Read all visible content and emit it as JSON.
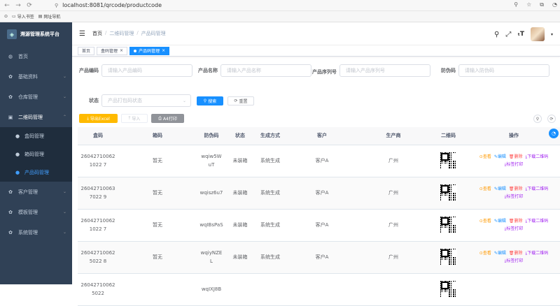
{
  "browser": {
    "url": "localhost:8081/qrcode/productcode",
    "bookmarks": [
      "导入书签",
      "网址导航"
    ]
  },
  "sidebar": {
    "title": "溯源管理系统平台",
    "items": [
      {
        "label": "首页",
        "icon": "dashboard-icon"
      },
      {
        "label": "基础资料",
        "icon": "settings-icon"
      },
      {
        "label": "仓库管理",
        "icon": "settings-icon"
      },
      {
        "label": "二维码管理",
        "icon": "qrcode-icon"
      },
      {
        "label": "盒码管理",
        "icon": "user-icon"
      },
      {
        "label": "箱码管理",
        "icon": "user-icon"
      },
      {
        "label": "产品码管理",
        "icon": "user-icon"
      },
      {
        "label": "客户管理",
        "icon": "settings-icon"
      },
      {
        "label": "模板管理",
        "icon": "settings-icon"
      },
      {
        "label": "系统管理",
        "icon": "settings-icon"
      }
    ]
  },
  "header": {
    "breadcrumb": [
      "首页",
      "二维码管理",
      "产品码管理"
    ]
  },
  "tags": [
    "首页",
    "盒码管理",
    "产品码管理"
  ],
  "filters": {
    "product_code": {
      "label": "产品编码",
      "placeholder": "请输入产品编码"
    },
    "product_name": {
      "label": "产品名称",
      "placeholder": "请输入产品名称"
    },
    "serial_no": {
      "label": "产品序列号",
      "placeholder": "请输入产品序列号"
    },
    "anti_fake": {
      "label": "防伪码",
      "placeholder": "请输入防伪码"
    },
    "status": {
      "label": "状态",
      "placeholder": "产品打包码状态"
    },
    "search_label": "搜索",
    "reset_label": "重置"
  },
  "toolbar": {
    "export_label": "导出Excel",
    "import_label": "导入",
    "print_label": "A4打印"
  },
  "table": {
    "headers": [
      "盒码",
      "箱码",
      "防伪码",
      "状态",
      "生成方式",
      "客户",
      "生产商",
      "二维码",
      "操作"
    ],
    "rows": [
      {
        "box": "260427100621022 7",
        "case": "暂无",
        "anti": "wqiw5W uT",
        "status": "未装箱",
        "mode": "系统生成",
        "customer": "客户A",
        "maker": "广州"
      },
      {
        "box": "260427100637022 9",
        "case": "暂无",
        "anti": "wqisz6u7",
        "status": "未装箱",
        "mode": "系统生成",
        "customer": "客户A",
        "maker": "广州"
      },
      {
        "box": "260427100621022 7",
        "case": "暂无",
        "anti": "wqIBsPaS",
        "status": "未装箱",
        "mode": "系统生成",
        "customer": "客户A",
        "maker": "广州"
      },
      {
        "box": "260427100625022 8",
        "case": "暂无",
        "anti": "wqiyNZEL",
        "status": "未装箱",
        "mode": "系统生成",
        "customer": "客户A",
        "maker": "广州"
      },
      {
        "box": "260427100625022",
        "case": "",
        "anti": "wqIXJ8B",
        "status": "",
        "mode": "",
        "customer": "",
        "maker": ""
      }
    ],
    "ops": {
      "view": "查看",
      "edit": "编辑",
      "delete": "删除",
      "download": "下载二维码",
      "print": "标签打印"
    }
  },
  "colors": {
    "sidebar_bg": "#304156",
    "primary": "#1890ff",
    "warning": "#ffba00"
  }
}
